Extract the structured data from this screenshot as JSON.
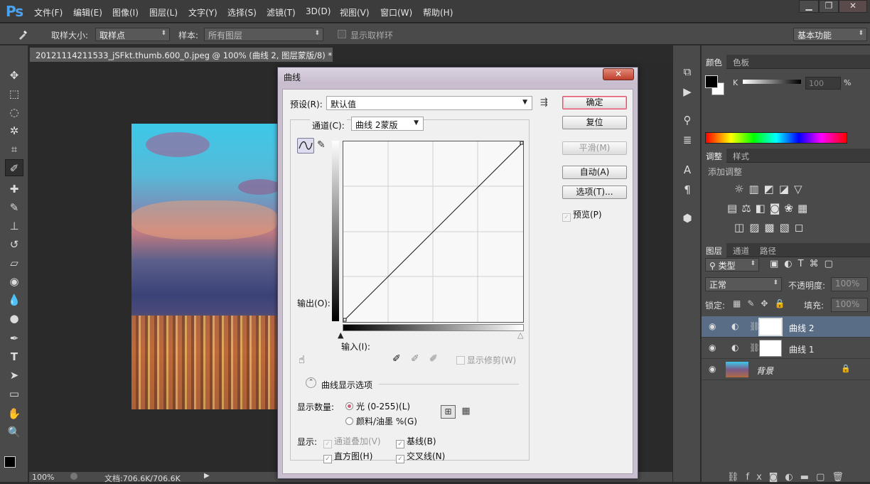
{
  "app": {
    "logo": "Ps"
  },
  "menu": [
    "文件(F)",
    "编辑(E)",
    "图像(I)",
    "图层(L)",
    "文字(Y)",
    "选择(S)",
    "滤镜(T)",
    "3D(D)",
    "视图(V)",
    "窗口(W)",
    "帮助(H)"
  ],
  "window_controls": {
    "minimize": "▁",
    "restore": "❐",
    "close": "✕"
  },
  "options_bar": {
    "tool_icon": "eyedropper-icon",
    "sample_size_label": "取样大小:",
    "sample_size_value": "取样点",
    "sample_label": "样本:",
    "sample_value": "所有图层",
    "show_ring_label": "显示取样环",
    "workspace": "基本功能"
  },
  "document": {
    "tab_title": "20121114211533_jSFkt.thumb.600_0.jpeg @ 100% (曲线 2, 图层蒙版/8) *",
    "tab_close": "×",
    "zoom": "100%",
    "doc_size": "文档:706.6K/706.6K"
  },
  "dialog": {
    "title": "曲线",
    "close": "✕",
    "preset_label": "预设(R):",
    "preset_value": "默认值",
    "channel_label": "通道(C):",
    "channel_value": "曲线 2蒙版",
    "output_label": "输出(O):",
    "input_label": "输入(I):",
    "show_clipping_label": "显示修剪(W)",
    "buttons": {
      "ok": "确定",
      "reset": "复位",
      "smooth": "平滑(M)",
      "auto": "自动(A)",
      "options": "选项(T)..."
    },
    "preview_label": "预览(P)",
    "display_options_label": "曲线显示选项",
    "show_amount_label": "显示数量:",
    "light_option": "光 (0-255)(L)",
    "pigment_option": "颜料/油墨 %(G)",
    "show_label": "显示:",
    "channel_overlay": "通道叠加(V)",
    "baseline": "基线(B)",
    "histogram": "直方图(H)",
    "intersection": "交叉线(N)"
  },
  "color_panel": {
    "tabs": [
      "颜色",
      "色板"
    ],
    "channel": "K",
    "value": "100",
    "unit": "%"
  },
  "adjustments_panel": {
    "tabs": [
      "调整",
      "样式"
    ],
    "heading": "添加调整"
  },
  "layers_panel": {
    "tabs": [
      "图层",
      "通道",
      "路径"
    ],
    "filter_label": "类型",
    "blend_mode": "正常",
    "opacity_label": "不透明度:",
    "opacity_value": "100%",
    "lock_label": "锁定:",
    "fill_label": "填充:",
    "fill_value": "100%",
    "layers": [
      {
        "name": "曲线 2",
        "selected": true
      },
      {
        "name": "曲线 1",
        "selected": false
      },
      {
        "name": "背景",
        "selected": false
      }
    ]
  },
  "colors": {
    "ps_blue": "#4aa3f0",
    "dialog_frame": "#c9bfcf",
    "selected_layer": "#596d86"
  }
}
